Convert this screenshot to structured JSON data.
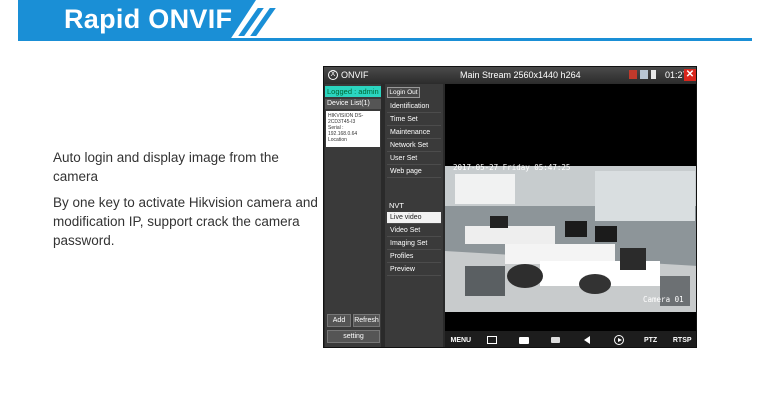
{
  "banner": {
    "title": "Rapid ONVIF",
    "color": "#1a8fd6"
  },
  "description": {
    "line1": "Auto login and display image from the camera",
    "line2": "By one key to activate Hikvision camera and modification IP, support crack the camera password."
  },
  "device": {
    "app_name": "ONVIF",
    "stream_title": "Main Stream 2560x1440 h264",
    "clock": "01:27",
    "status_icons": [
      "sd-card-icon",
      "network-icon",
      "battery-icon"
    ],
    "close_icon": "close-icon",
    "sidebar": {
      "logged_in": "Logged : admin",
      "device_list": "Device List(1)",
      "device_card": {
        "name": "HIKVISION DS-2CD3T45-I3",
        "serial": "Serial :",
        "ip": "192.168.0.64",
        "location": "Location"
      },
      "add_label": "Add",
      "refresh_label": "Refresh",
      "setting_label": "setting"
    },
    "menu": {
      "login_out": "Login Out",
      "items": [
        "Identification",
        "Time Set",
        "Maintenance",
        "Network Set",
        "User Set",
        "Web page"
      ],
      "section": "NVT",
      "nvt_items": [
        "Live video",
        "Video Set",
        "Imaging Set",
        "Profiles",
        "Preview"
      ],
      "active": "Live video"
    },
    "video": {
      "osd_datetime": "2017-05-27 Friday 05:47:25",
      "osd_camera": "Camera 01"
    },
    "bottom_bar": {
      "menu": "MENU",
      "ptz": "PTZ",
      "rtsp": "RTSP",
      "icons": [
        "image-icon",
        "camera-icon",
        "record-icon",
        "volume-icon",
        "play-icon"
      ]
    }
  }
}
